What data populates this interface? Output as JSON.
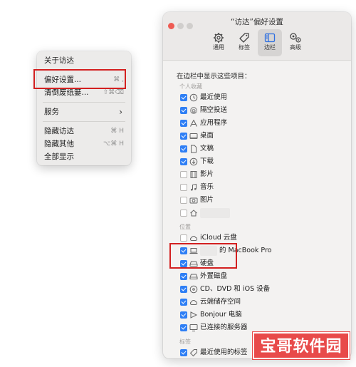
{
  "menu": {
    "items": [
      {
        "label": "关于访达",
        "shortcut": ""
      },
      {
        "label": "偏好设置...",
        "shortcut": "⌘ ,"
      },
      {
        "label": "清倒废纸篓...",
        "shortcut": "⇧⌘⌫"
      },
      {
        "label": "服务",
        "shortcut": ""
      },
      {
        "label": "隐藏访达",
        "shortcut": "⌘ H"
      },
      {
        "label": "隐藏其他",
        "shortcut": "⌥⌘ H"
      },
      {
        "label": "全部显示",
        "shortcut": ""
      }
    ],
    "submenu_arrow": "›"
  },
  "window": {
    "title": "“访达”偏好设置",
    "tabs": [
      {
        "label": "通用",
        "icon": "gear-icon"
      },
      {
        "label": "标签",
        "icon": "tag-icon"
      },
      {
        "label": "边栏",
        "icon": "sidebar-icon",
        "active": true
      },
      {
        "label": "高级",
        "icon": "gears-icon"
      }
    ],
    "intro": "在边栏中显示这些项目：",
    "sections": {
      "favorites": "个人收藏",
      "locations": "位置",
      "tags": "标签"
    },
    "favorites": [
      {
        "label": "最近使用",
        "checked": true,
        "icon": "clock-icon"
      },
      {
        "label": "隔空投送",
        "checked": true,
        "icon": "airdrop-icon"
      },
      {
        "label": "应用程序",
        "checked": true,
        "icon": "apps-icon"
      },
      {
        "label": "桌面",
        "checked": true,
        "icon": "desktop-icon"
      },
      {
        "label": "文稿",
        "checked": true,
        "icon": "document-icon"
      },
      {
        "label": "下载",
        "checked": true,
        "icon": "download-icon"
      },
      {
        "label": "影片",
        "checked": false,
        "icon": "film-icon"
      },
      {
        "label": "音乐",
        "checked": false,
        "icon": "music-icon"
      },
      {
        "label": "图片",
        "checked": false,
        "icon": "camera-icon"
      },
      {
        "label": "",
        "checked": false,
        "icon": "home-icon"
      }
    ],
    "locations": [
      {
        "label": "iCloud 云盘",
        "checked": false,
        "icon": "cloud-icon"
      },
      {
        "label": "的 MacBook Pro",
        "checked": true,
        "icon": "laptop-icon"
      },
      {
        "label": "硬盘",
        "checked": true,
        "icon": "disk-icon"
      },
      {
        "label": "外置磁盘",
        "checked": true,
        "icon": "disk-icon"
      },
      {
        "label": "CD、DVD 和 iOS 设备",
        "checked": true,
        "icon": "disc-icon"
      },
      {
        "label": "云端储存空间",
        "checked": true,
        "icon": "cloud-icon"
      },
      {
        "label": "Bonjour 电脑",
        "checked": true,
        "icon": "bonjour-icon"
      },
      {
        "label": "已连接的服务器",
        "checked": true,
        "icon": "monitor-icon"
      }
    ],
    "tags": [
      {
        "label": "最近使用的标签",
        "checked": true,
        "icon": "tag-icon"
      }
    ]
  },
  "watermark": {
    "text": "宝哥软件园"
  },
  "colors": {
    "accent": "#2f7ff5",
    "highlight": "#d32020",
    "watermark": "#e84a4a"
  }
}
